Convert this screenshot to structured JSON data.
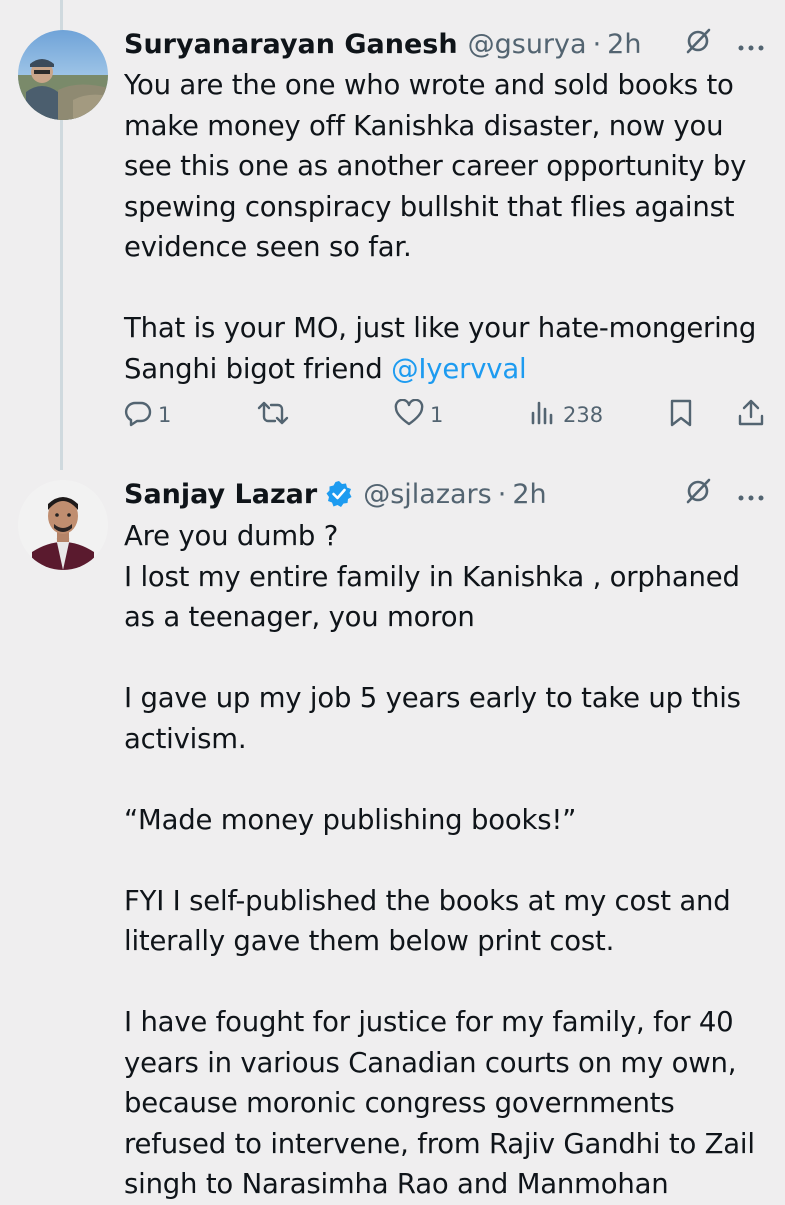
{
  "tweets": [
    {
      "name": "Suryanarayan Ganesh",
      "handle": "@gsurya",
      "dot": "·",
      "time": "2h",
      "verified": false,
      "text": "You are the one who wrote and sold books to make money off Kanishka disaster, now you see this one as another career opportunity by spewing conspiracy bullshit that flies against evidence seen so far.\n\nThat is your MO, just like your hate-mongering Sanghi bigot friend ",
      "mention": "@Iyervval",
      "actions": {
        "replies": "1",
        "reposts": "",
        "likes": "1",
        "views": "238"
      }
    },
    {
      "name": "Sanjay Lazar",
      "handle": "@sjlazars",
      "dot": "·",
      "time": "2h",
      "verified": true,
      "text": "Are you dumb ?\nI lost my entire family in Kanishka , orphaned as a teenager, you moron\n\nI gave up my job 5 years early to take up this activism.\n\n“Made money publishing books!”\n\nFYI I self-published the books at my cost and literally gave them below print cost.\n\nI have fought for justice for my family, for 40 years in various Canadian courts on my own, because moronic congress governments refused to intervene, from Rajiv Gandhi to Zail singh to Narasimha Rao and Manmohan"
    }
  ],
  "icons": {
    "grok": "grok-icon",
    "more": "more-icon",
    "reply": "reply-icon",
    "repost": "repost-icon",
    "like": "like-icon",
    "views": "views-icon",
    "bookmark": "bookmark-icon",
    "share": "share-icon",
    "verified": "verified-badge-icon"
  },
  "colors": {
    "background": "#efeeef",
    "text": "#0f1419",
    "secondary": "#536471",
    "link": "#1d9bf0",
    "thread_line": "#cfd9de"
  }
}
